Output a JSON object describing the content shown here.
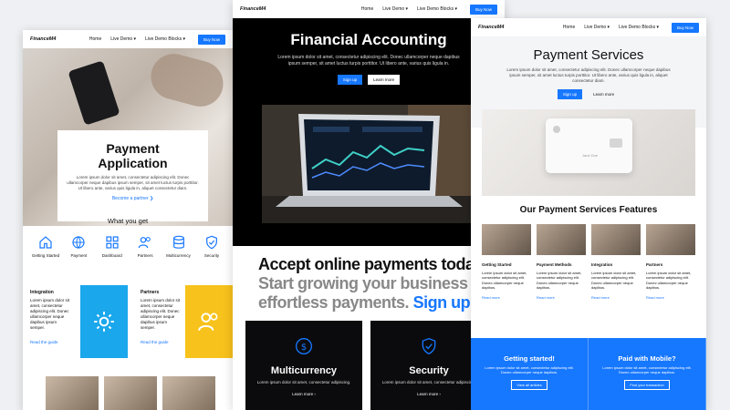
{
  "nav": {
    "logo": "FinanceM4",
    "links": [
      "Home",
      "Live Demo ▾",
      "Live Demo Blocks ▾"
    ],
    "cta": "Buy Now"
  },
  "left": {
    "hero_title": "Payment\nApplication",
    "hero_text": "Lorem ipsum dolor sit amet, consectetur adipiscing elit. Donec ullamcorper neque dapibus ipsum semper, sit amet luctus turpis porttitor. Ut libero ante, varius quis ligula in, aliquet consectetur diam.",
    "hero_link": "Become a partner ❯",
    "section_title": "What you get",
    "features": [
      "Getting Started",
      "Payment",
      "Dashboard",
      "Partners",
      "Multicurrency",
      "Security"
    ],
    "blocks": [
      {
        "title": "Integration",
        "text": "Lorem ipsum dolor sit amet, consectetur adipiscing elit. Donec ullamcorper neque dapibus ipsum semper.",
        "link": "Read the guide"
      },
      {
        "title": "Partners",
        "text": "Lorem ipsum dolor sit amet, consectetur adipiscing elit. Donec ullamcorper neque dapibus ipsum semper.",
        "link": "Read the guide"
      }
    ]
  },
  "middle": {
    "title": "Financial Accounting",
    "text": "Lorem ipsum dolor sit amet, consectetur adipiscing elit. Donec ullamcorper neque dapibus ipsum semper, sit amet luctus turpis porttitor. Ut libero ante, varius quis ligula in.",
    "signup": "Sign up",
    "learn": "Learn more",
    "big_line1": "Accept online payments today.",
    "big_line2": "Start growing your business with effortless payments.",
    "big_link": "Sign up »",
    "cards": [
      {
        "title": "Multicurrency",
        "text": "Lorem ipsum dolor sit amet, consectetur adipiscing.",
        "link": "Learn more ›"
      },
      {
        "title": "Security",
        "text": "Lorem ipsum dolor sit amet, consectetur adipiscing.",
        "link": "Learn more ›"
      }
    ]
  },
  "right": {
    "title": "Payment Services",
    "text": "Lorem ipsum dolor sit amet, consectetur adipiscing elit. Donec ullamcorper neque dapibus ipsum semper, sit amet luctus turpis porttitor. Ut libero ante, varius quis ligula in, aliquet consectetur diam.",
    "signup": "Sign up",
    "learn": "Learn more",
    "card_name": "Jane Doe",
    "features_title": "Our Payment Services Features",
    "features": [
      {
        "title": "Getting Started",
        "text": "Lorem ipsum dolor sit amet, consectetur adipiscing elit. Donec ullamcorper neque dapibus.",
        "link": "Read more"
      },
      {
        "title": "Payment Methods",
        "text": "Lorem ipsum dolor sit amet, consectetur adipiscing elit. Donec ullamcorper neque dapibus.",
        "link": "Read more"
      },
      {
        "title": "Integration",
        "text": "Lorem ipsum dolor sit amet, consectetur adipiscing elit. Donec ullamcorper neque dapibus.",
        "link": "Read more"
      },
      {
        "title": "Partners",
        "text": "Lorem ipsum dolor sit amet, consectetur adipiscing elit. Donec ullamcorper neque dapibus.",
        "link": "Read more"
      }
    ],
    "cta_blocks": [
      {
        "title": "Getting started!",
        "text": "Lorem ipsum dolor sit amet, consectetur adipiscing elit. Donec ullamcorper neque dapibus.",
        "button": "View all articles"
      },
      {
        "title": "Paid with Mobile?",
        "text": "Lorem ipsum dolor sit amet, consectetur adipiscing elit. Donec ullamcorper neque dapibus.",
        "button": "Find your transaction"
      }
    ]
  },
  "colors": {
    "accent": "#1677ff",
    "yellow": "#f7c21b",
    "dark": "#000000"
  }
}
